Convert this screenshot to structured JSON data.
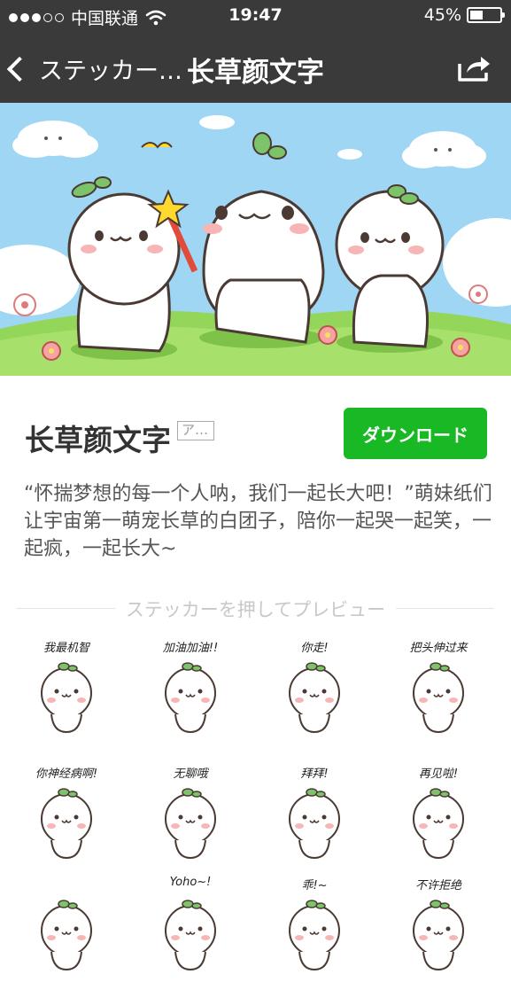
{
  "status_bar": {
    "carrier": "中国联通",
    "time": "19:47",
    "battery_percent_text": "45%",
    "battery_level": 0.45,
    "signal_bars_filled": 3,
    "signal_bars_total": 5
  },
  "nav": {
    "back_label": "ステッカー…",
    "title": "长草颜文字",
    "share_icon": "share-icon"
  },
  "package": {
    "title": "长草颜文字",
    "tag": "ア…",
    "download_label": "ダウンロード",
    "description": "“怀揣梦想的每一个人呐，我们一起长大吧！”萌妹纸们让宇宙第一萌宠长草的白团子，陪你一起哭一起笑，一起疯，一起长大~"
  },
  "preview": {
    "label": "ステッカーを押してプレビュー",
    "stickers": [
      {
        "caption": "我最机智"
      },
      {
        "caption": "加油加油!!"
      },
      {
        "caption": "你走!"
      },
      {
        "caption": "把头伸过来"
      },
      {
        "caption": "你神经病啊!"
      },
      {
        "caption": "无聊哦"
      },
      {
        "caption": "拜拜!"
      },
      {
        "caption": "再见啦!"
      },
      {
        "caption": ""
      },
      {
        "caption": "Yoho~!"
      },
      {
        "caption": "乖!~"
      },
      {
        "caption": "不许拒绝"
      }
    ]
  },
  "colors": {
    "bar": "#3a3a3a",
    "download": "#19b825",
    "sky": "#9ed6f4",
    "grass": "#93d65a"
  }
}
